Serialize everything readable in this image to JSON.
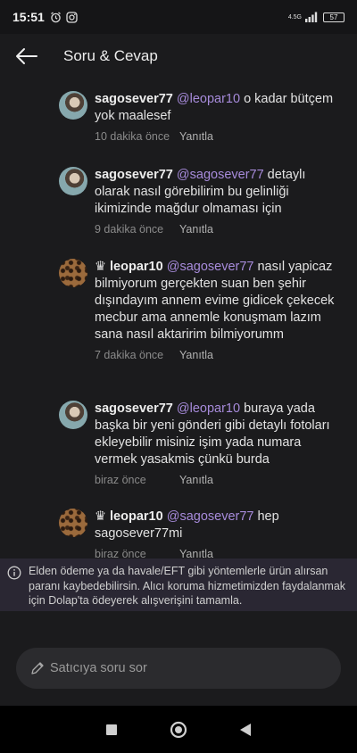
{
  "status_bar": {
    "time": "15:51",
    "network": "4.5G",
    "battery": "57"
  },
  "header": {
    "title": "Soru & Cevap",
    "back_icon": "arrow-left-icon"
  },
  "messages": [
    {
      "user": "sagosever77",
      "mention": "@leopar10",
      "text": " o kadar bütçem yok maalesef",
      "time": "10 dakika önce",
      "reply": "Yanıtla",
      "avatar": "girl-avatar"
    },
    {
      "user": "sagosever77",
      "mention": "@sagosever77",
      "text": " detaylı olarak nasıl görebilirim bu gelinliği ikimizinde mağdur olmaması için",
      "time": "9 dakika önce",
      "reply": "Yanıtla",
      "avatar": "girl-avatar"
    },
    {
      "user": "leopar10",
      "mention": "@sagosever77",
      "text": " nasıl yapicaz bilmiyorum gerçekten suan ben şehir dışındayım annem evime gidicek çekecek mecbur ama annemle konuşmam lazım sana nasıl aktaririm bilmiyorumm",
      "time": "7 dakika önce",
      "reply": "Yanıtla",
      "avatar": "leopard-avatar",
      "badge": "crown-icon"
    },
    {
      "user": "sagosever77",
      "mention": "@leopar10",
      "text": " buraya yada başka bir yeni gönderi gibi detaylı fotoları ekleyebilir misiniz işim yada numara vermek yasakmis çünkü burda",
      "time": "biraz önce",
      "reply": "Yanıtla",
      "avatar": "girl-avatar"
    },
    {
      "user": "leopar10",
      "mention": "@sagosever77",
      "text": " hep sagosever77mi",
      "time": "biraz önce",
      "reply": "Yanıtla",
      "avatar": "leopard-avatar",
      "badge": "crown-icon"
    }
  ],
  "notice": {
    "text": "Elden ödeme ya da havale/EFT gibi yöntemlerle ürün alırsan paranı kaybedebilirsin. Alıcı koruma hizmetimizden faydalanmak için Dolap'ta ödeyerek alışverişini tamamla.",
    "icon": "info-icon"
  },
  "ask": {
    "placeholder": "Satıcıya soru sor",
    "icon": "pencil-icon"
  },
  "nav": {
    "icons": [
      "recents-square-icon",
      "home-circle-icon",
      "back-triangle-icon"
    ]
  }
}
